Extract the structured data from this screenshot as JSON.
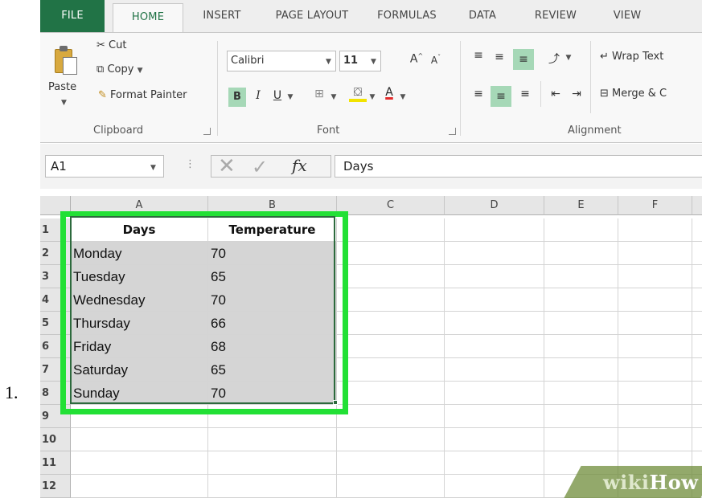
{
  "step_number": "1.",
  "ribbon": {
    "tabs": [
      "FILE",
      "HOME",
      "INSERT",
      "PAGE LAYOUT",
      "FORMULAS",
      "DATA",
      "REVIEW",
      "VIEW"
    ],
    "clipboard": {
      "paste": "Paste",
      "cut": "Cut",
      "copy": "Copy",
      "format_painter": "Format Painter",
      "group_label": "Clipboard"
    },
    "font": {
      "font_name": "Calibri",
      "font_size": "11",
      "bold": "B",
      "italic": "I",
      "underline": "U",
      "group_label": "Font"
    },
    "alignment": {
      "wrap_text": "Wrap Text",
      "merge": "Merge & C",
      "group_label": "Alignment"
    }
  },
  "formula_bar": {
    "name_box": "A1",
    "fx": "fx",
    "value": "Days"
  },
  "grid": {
    "columns": [
      "A",
      "B",
      "C",
      "D",
      "E",
      "F"
    ],
    "rows": [
      "1",
      "2",
      "3",
      "4",
      "5",
      "6",
      "7",
      "8",
      "9",
      "10",
      "11",
      "12"
    ],
    "headers": [
      "Days",
      "Temperature"
    ],
    "data": [
      [
        "Monday",
        "70"
      ],
      [
        "Tuesday",
        "65"
      ],
      [
        "Wednesday",
        "70"
      ],
      [
        "Thursday",
        "66"
      ],
      [
        "Friday",
        "68"
      ],
      [
        "Saturday",
        "65"
      ],
      [
        "Sunday",
        "70"
      ]
    ]
  },
  "watermark": {
    "wiki": "wiki",
    "how": "How"
  },
  "colors": {
    "excel_green": "#217346",
    "highlight_green": "#22e035",
    "selection_shade": "#d5d5d5"
  }
}
